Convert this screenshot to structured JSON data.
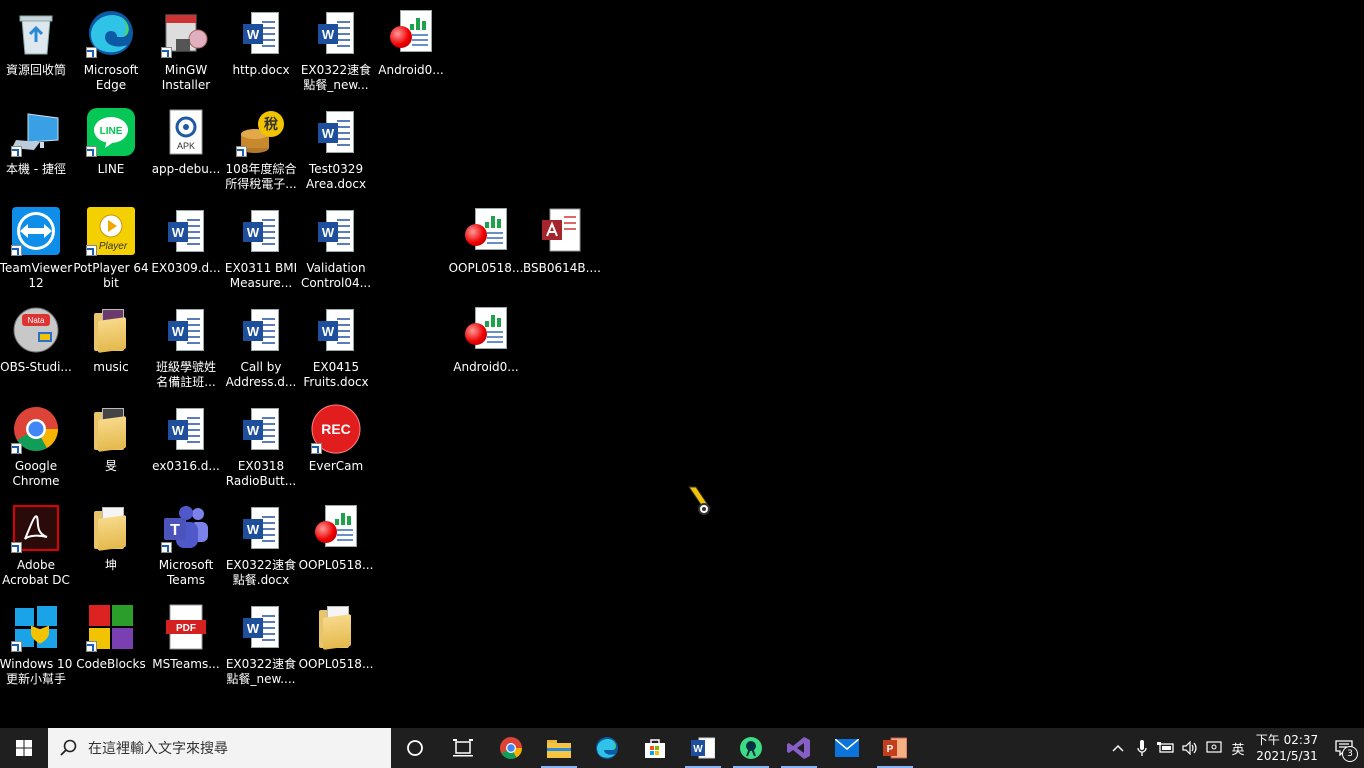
{
  "desktop": {
    "icons": [
      {
        "label": "資源回收筒",
        "icon": "recycle-bin-icon"
      },
      {
        "label": "Microsoft\nEdge",
        "icon": "edge-icon"
      },
      {
        "label": "MinGW\nInstaller",
        "icon": "installer-icon"
      },
      {
        "label": "http.docx",
        "icon": "word-doc-icon"
      },
      {
        "label": "EX0322速食\n點餐_new...",
        "icon": "word-doc-icon"
      },
      {
        "label": "Android0...",
        "icon": "chart-file-icon"
      },
      {
        "label": "本機 - 捷徑",
        "icon": "computer-icon"
      },
      {
        "label": "LINE",
        "icon": "line-icon"
      },
      {
        "label": "app-debu...",
        "icon": "apk-icon"
      },
      {
        "label": "108年度綜合\n所得稅電子...",
        "icon": "tax-icon"
      },
      {
        "label": "Test0329\nArea.docx",
        "icon": "word-doc-icon"
      },
      {
        "label": "TeamViewer\n12",
        "icon": "teamviewer-icon"
      },
      {
        "label": "PotPlayer 64\nbit",
        "icon": "potplayer-icon"
      },
      {
        "label": "EX0309.d...",
        "icon": "word-doc-icon"
      },
      {
        "label": "EX0311 BMI\nMeasure...",
        "icon": "word-doc-icon"
      },
      {
        "label": "Validation\nControl04...",
        "icon": "word-doc-icon"
      },
      {
        "label": "OOPL0518...",
        "icon": "chart-file-icon"
      },
      {
        "label": "BSB0614B....",
        "icon": "access-file-icon"
      },
      {
        "label": "OBS-Studi...",
        "icon": "obs-icon"
      },
      {
        "label": "music",
        "icon": "folder-icon"
      },
      {
        "label": "班級學號姓\n名備註班...",
        "icon": "word-doc-icon"
      },
      {
        "label": "Call by\nAddress.d...",
        "icon": "word-doc-icon"
      },
      {
        "label": "EX0415\nFruits.docx",
        "icon": "word-doc-icon"
      },
      {
        "label": "Android0...",
        "icon": "chart-file-icon"
      },
      {
        "label": "Google\nChrome",
        "icon": "chrome-icon"
      },
      {
        "label": "旻",
        "icon": "folder-icon"
      },
      {
        "label": "ex0316.d...",
        "icon": "word-doc-icon"
      },
      {
        "label": "EX0318\nRadioButt...",
        "icon": "word-doc-icon"
      },
      {
        "label": "EverCam",
        "icon": "evercam-rec-icon",
        "rec_text": "REC"
      },
      {
        "label": "Adobe\nAcrobat DC",
        "icon": "acrobat-icon"
      },
      {
        "label": "坤",
        "icon": "folder-icon"
      },
      {
        "label": "Microsoft\nTeams",
        "icon": "teams-icon"
      },
      {
        "label": "EX0322速食\n點餐.docx",
        "icon": "word-doc-icon"
      },
      {
        "label": "OOPL0518...",
        "icon": "chart-file-icon"
      },
      {
        "label": "Windows 10\n更新小幫手",
        "icon": "windows-update-icon"
      },
      {
        "label": "CodeBlocks",
        "icon": "codeblocks-icon"
      },
      {
        "label": "MSTeams...",
        "icon": "pdf-icon",
        "pdf_text": "PDF"
      },
      {
        "label": "EX0322速食\n點餐_new....",
        "icon": "word-doc-icon"
      },
      {
        "label": "OOPL0518...",
        "icon": "folder-icon"
      }
    ],
    "icon_badges": {
      "line_text": "LINE",
      "apk_text": "APK",
      "tax_text": "稅",
      "potplayer_text": "Player",
      "teams_text": "T",
      "word_text": "W",
      "obs_text": "Nata"
    }
  },
  "taskbar": {
    "start": "windows-start-icon",
    "search_placeholder": "在這裡輸入文字來搜尋",
    "pinned": [
      "cortana-icon",
      "task-view-icon",
      "chrome-icon",
      "file-explorer-icon",
      "edge-icon",
      "store-icon",
      "word-icon",
      "android-studio-icon",
      "visual-studio-icon",
      "mail-icon",
      "powerpoint-icon"
    ],
    "tray": {
      "ime": "英",
      "time": "下午 02:37",
      "date": "2021/5/31",
      "notification_count": "3"
    }
  },
  "colors": {
    "desktop_bg": "#000000",
    "taskbar_bg": "#1f1f1f",
    "word_blue": "#1d4f9c",
    "accent": "#8ab4f8"
  }
}
